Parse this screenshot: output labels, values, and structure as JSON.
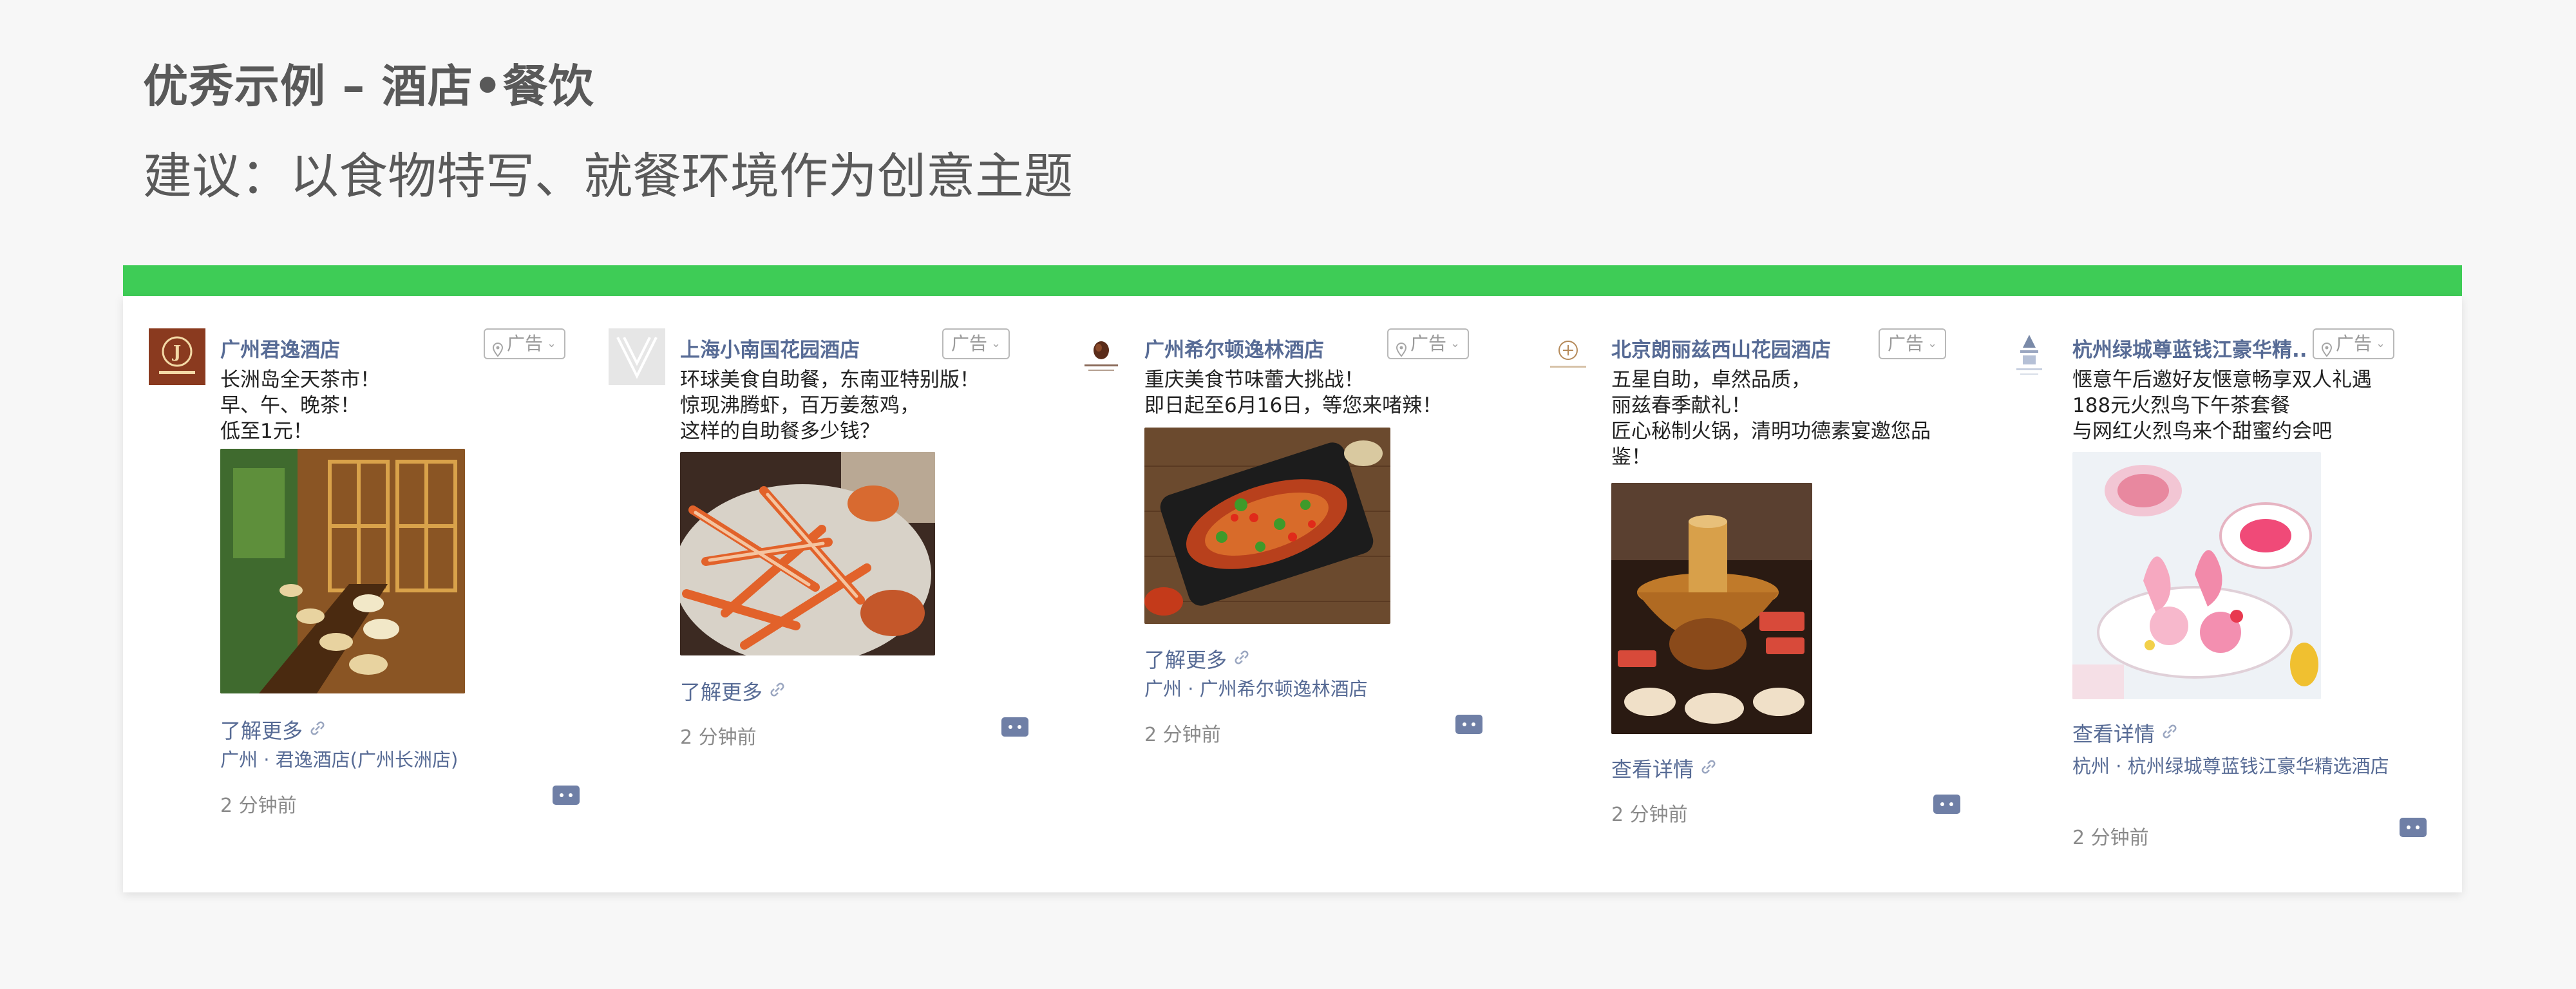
{
  "slide": {
    "title": "优秀示例 – 酒店•餐饮",
    "subtitle": "建议：以食物特写、就餐环境作为创意主题"
  },
  "colors": {
    "accent_green": "#3ecc56",
    "link_blue": "#576b95",
    "title_gray": "#595959"
  },
  "ads": [
    {
      "name": "广州君逸酒店",
      "ad_label": "广告",
      "lines": [
        "长洲岛全天茶市！",
        "早、午、晚茶！",
        "低至1元！"
      ],
      "image_icon": "hotel-lobby-photo",
      "more": "了解更多",
      "location": "广州 · 君逸酒店(广州长洲店)",
      "time": "2 分钟前"
    },
    {
      "name": "上海小南国花园酒店",
      "ad_label": "广告",
      "lines": [
        "环球美食自助餐，东南亚特别版！",
        "惊现沸腾虾，百万姜葱鸡，",
        "这样的自助餐多少钱？"
      ],
      "image_icon": "crab-legs-photo",
      "more": "了解更多",
      "location": "",
      "time": "2 分钟前"
    },
    {
      "name": "广州希尔顿逸林酒店",
      "ad_label": "广告",
      "lines": [
        "重庆美食节味蕾大挑战！",
        "即日起至6月16日，等您来啫辣！"
      ],
      "image_icon": "grilled-fish-photo",
      "more": "了解更多",
      "location": "广州 · 广州希尔顿逸林酒店",
      "time": "2 分钟前"
    },
    {
      "name": "北京朗丽兹西山花园酒店",
      "ad_label": "广告",
      "lines": [
        "五星自助，卓然品质，",
        "丽兹春季献礼！",
        "匠心秘制火锅，清明功德素宴邀您品",
        "鉴！"
      ],
      "image_icon": "hotpot-photo",
      "more": "查看详情",
      "location": "",
      "time": "2 分钟前"
    },
    {
      "name": "杭州绿城尊蓝钱江豪华精..",
      "ad_label": "广告",
      "lines": [
        "惬意午后邀好友惬意畅享双人礼遇",
        "188元火烈鸟下午茶套餐",
        "与网红火烈鸟来个甜蜜约会吧"
      ],
      "image_icon": "afternoon-tea-photo",
      "more": "查看详情",
      "location": "杭州 · 杭州绿城尊蓝钱江豪华精选酒店",
      "time": "2 分钟前"
    }
  ]
}
